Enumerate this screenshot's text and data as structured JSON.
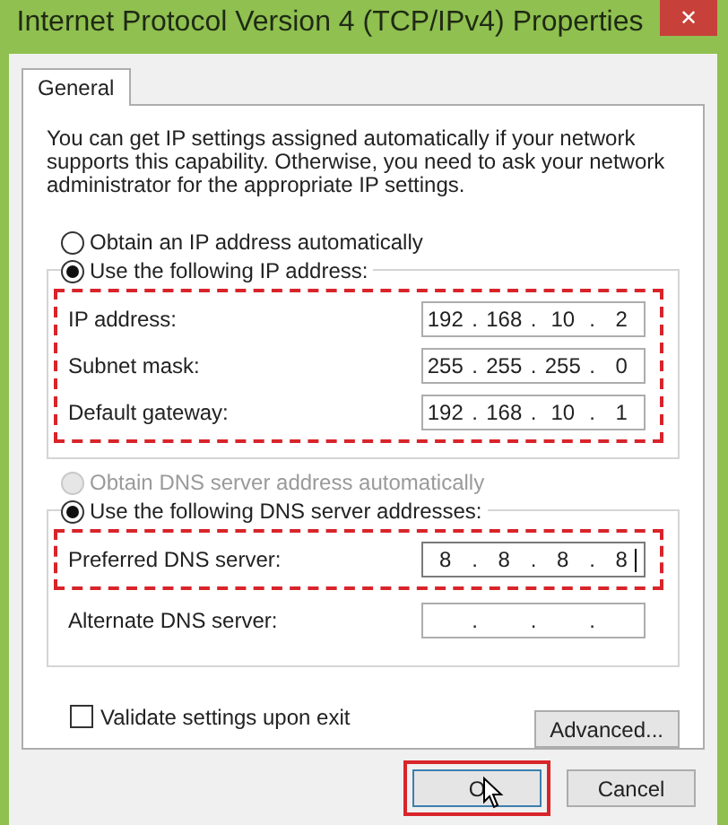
{
  "window": {
    "title": "Internet Protocol Version 4 (TCP/IPv4) Properties",
    "close": "✕"
  },
  "tabs": [
    {
      "label": "General",
      "selected": true
    }
  ],
  "description": "You can get IP settings assigned automatically if your network supports this capability. Otherwise, you need to ask your network administrator for the appropriate IP settings.",
  "ip_options": [
    {
      "label": "Obtain an IP address automatically",
      "selected": false,
      "disabled": false
    },
    {
      "label": "Use the following IP address:",
      "selected": true,
      "disabled": false
    }
  ],
  "ip_fields": {
    "highlighted": true,
    "separator": ".",
    "rows": [
      {
        "label": "IP address:",
        "octets": [
          "192",
          "168",
          "10",
          "2"
        ],
        "focused": false
      },
      {
        "label": "Subnet mask:",
        "octets": [
          "255",
          "255",
          "255",
          "0"
        ],
        "focused": false
      },
      {
        "label": "Default gateway:",
        "octets": [
          "192",
          "168",
          "10",
          "1"
        ],
        "focused": false
      }
    ]
  },
  "dns_options": [
    {
      "label": "Obtain DNS server address automatically",
      "selected": false,
      "disabled": true
    },
    {
      "label": "Use the following DNS server addresses:",
      "selected": true,
      "disabled": false
    }
  ],
  "dns_fields": [
    {
      "label": "Preferred DNS server:",
      "octets": [
        "8",
        "8",
        "8",
        "8"
      ],
      "focused": true,
      "highlighted": true
    },
    {
      "label": "Alternate DNS server:",
      "focused": false,
      "highlighted": false
    }
  ],
  "validate": {
    "label": "Validate settings upon exit",
    "checked": false
  },
  "advanced_button": "Advanced...",
  "buttons": [
    {
      "label": "O",
      "highlighted": true,
      "focused": true
    },
    {
      "label": "Cancel",
      "highlighted": false,
      "focused": false
    }
  ]
}
